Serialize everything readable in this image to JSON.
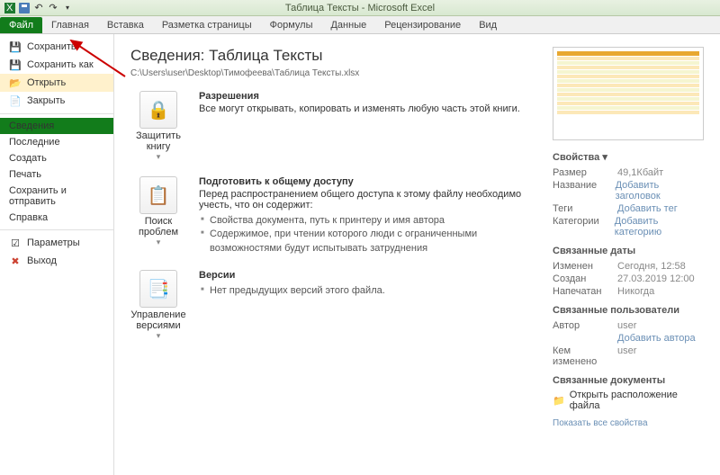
{
  "window": {
    "title": "Таблица Тексты - Microsoft Excel"
  },
  "tabs": {
    "file": "Файл",
    "home": "Главная",
    "insert": "Вставка",
    "layout": "Разметка страницы",
    "formulas": "Формулы",
    "data": "Данные",
    "review": "Рецензирование",
    "view": "Вид"
  },
  "sidebar": {
    "save": "Сохранить",
    "saveAs": "Сохранить как",
    "open": "Открыть",
    "close": "Закрыть",
    "info": "Сведения",
    "recent": "Последние",
    "new": "Создать",
    "print": "Печать",
    "share": "Сохранить и отправить",
    "help": "Справка",
    "options": "Параметры",
    "exit": "Выход"
  },
  "info": {
    "heading": "Сведения: Таблица Тексты",
    "path": "C:\\Users\\user\\Desktop\\Тимофеева\\Таблица Тексты.xlsx",
    "perm": {
      "title": "Разрешения",
      "text": "Все могут открывать, копировать и изменять любую часть этой книги.",
      "btn": "Защитить книгу",
      "drop": "▾"
    },
    "prep": {
      "title": "Подготовить к общему доступу",
      "text": "Перед распространением общего доступа к этому файлу необходимо учесть, что он содержит:",
      "li1": "Свойства документа, путь к принтеру и имя автора",
      "li2": "Содержимое, при чтении которого люди с ограниченными возможностями будут испытывать затруднения",
      "btn": "Поиск проблем",
      "drop": "▾"
    },
    "ver": {
      "title": "Версии",
      "li1": "Нет предыдущих версий этого файла.",
      "btn": "Управление версиями",
      "drop": "▾"
    }
  },
  "props": {
    "h1": "Свойства ▾",
    "size_k": "Размер",
    "size_v": "49,1Кбайт",
    "title_k": "Название",
    "title_v": "Добавить заголовок",
    "tags_k": "Теги",
    "tags_v": "Добавить тег",
    "cat_k": "Категории",
    "cat_v": "Добавить категорию",
    "h2": "Связанные даты",
    "mod_k": "Изменен",
    "mod_v": "Сегодня, 12:58",
    "cre_k": "Создан",
    "cre_v": "27.03.2019 12:00",
    "prn_k": "Напечатан",
    "prn_v": "Никогда",
    "h3": "Связанные пользователи",
    "auth_k": "Автор",
    "auth_v": "user",
    "addauth": "Добавить автора",
    "chby_k": "Кем изменено",
    "chby_v": "user",
    "h4": "Связанные документы",
    "loc": "Открыть расположение файла",
    "all": "Показать все свойства"
  }
}
